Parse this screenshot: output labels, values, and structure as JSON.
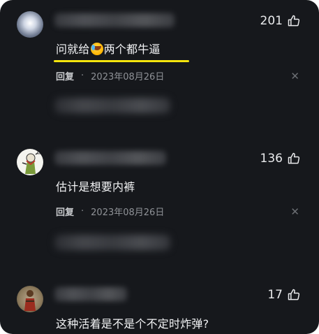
{
  "comments": [
    {
      "likes": "201",
      "text_before": "问就给",
      "emoji": "crying-laughing-emoji",
      "text_after": "两个都牛逼",
      "reply_label": "回复",
      "separator": "·",
      "date": "2023年08月26日",
      "close": "✕"
    },
    {
      "likes": "136",
      "text": "估计是想要内裤",
      "reply_label": "回复",
      "separator": "·",
      "date": "2023年08月26日",
      "close": "✕"
    },
    {
      "likes": "17",
      "text": "这种活着是不是个不定时炸弹?"
    }
  ],
  "colors": {
    "background": "#16181c",
    "highlight_underline": "#f5e60d",
    "text": "#f2f3f5",
    "meta": "#8f9297"
  }
}
